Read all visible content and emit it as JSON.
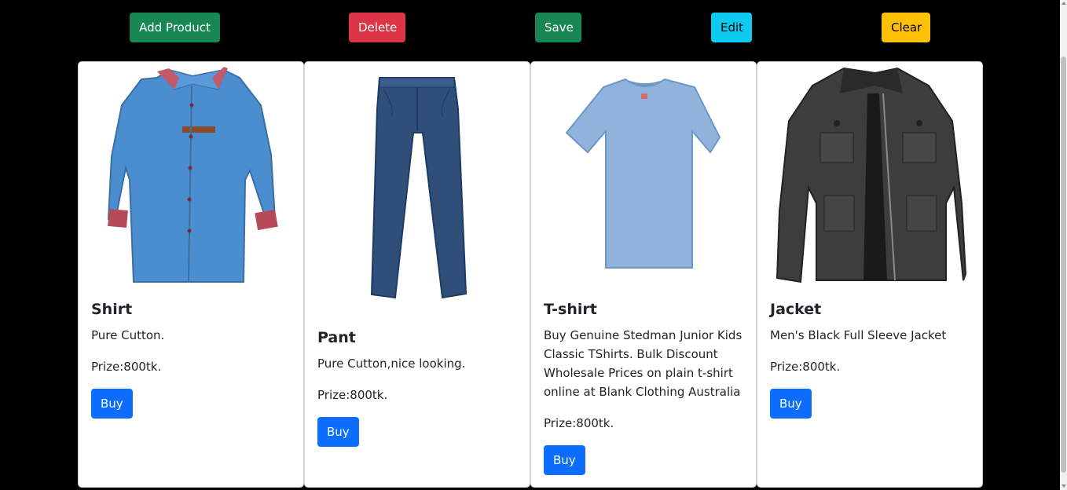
{
  "toolbar": {
    "add_product_label": "Add Product",
    "delete_label": "Delete",
    "save_label": "Save",
    "edit_label": "Edit",
    "clear_label": "Clear"
  },
  "colors": {
    "page_background": "#000000",
    "success": "#198754",
    "danger": "#dc3545",
    "info": "#0dcaf0",
    "warning": "#ffc107",
    "primary": "#0d6efd"
  },
  "products": [
    {
      "title": "Shirt",
      "description": "Pure Cutton.",
      "price": "Prize:800tk.",
      "buy_label": "Buy",
      "image_icon": "shirt-image"
    },
    {
      "title": "Pant",
      "description": "Pure Cutton,nice looking.",
      "price": "Prize:800tk.",
      "buy_label": "Buy",
      "image_icon": "pant-image"
    },
    {
      "title": "T-shirt",
      "description": "Buy Genuine Stedman Junior Kids Classic TShirts. Bulk Discount Wholesale Prices on plain t-shirt online at Blank Clothing Australia",
      "price": "Prize:800tk.",
      "buy_label": "Buy",
      "image_icon": "tshirt-image"
    },
    {
      "title": "Jacket",
      "description": "Men's Black Full Sleeve Jacket",
      "price": "Prize:800tk.",
      "buy_label": "Buy",
      "image_icon": "jacket-image"
    }
  ]
}
